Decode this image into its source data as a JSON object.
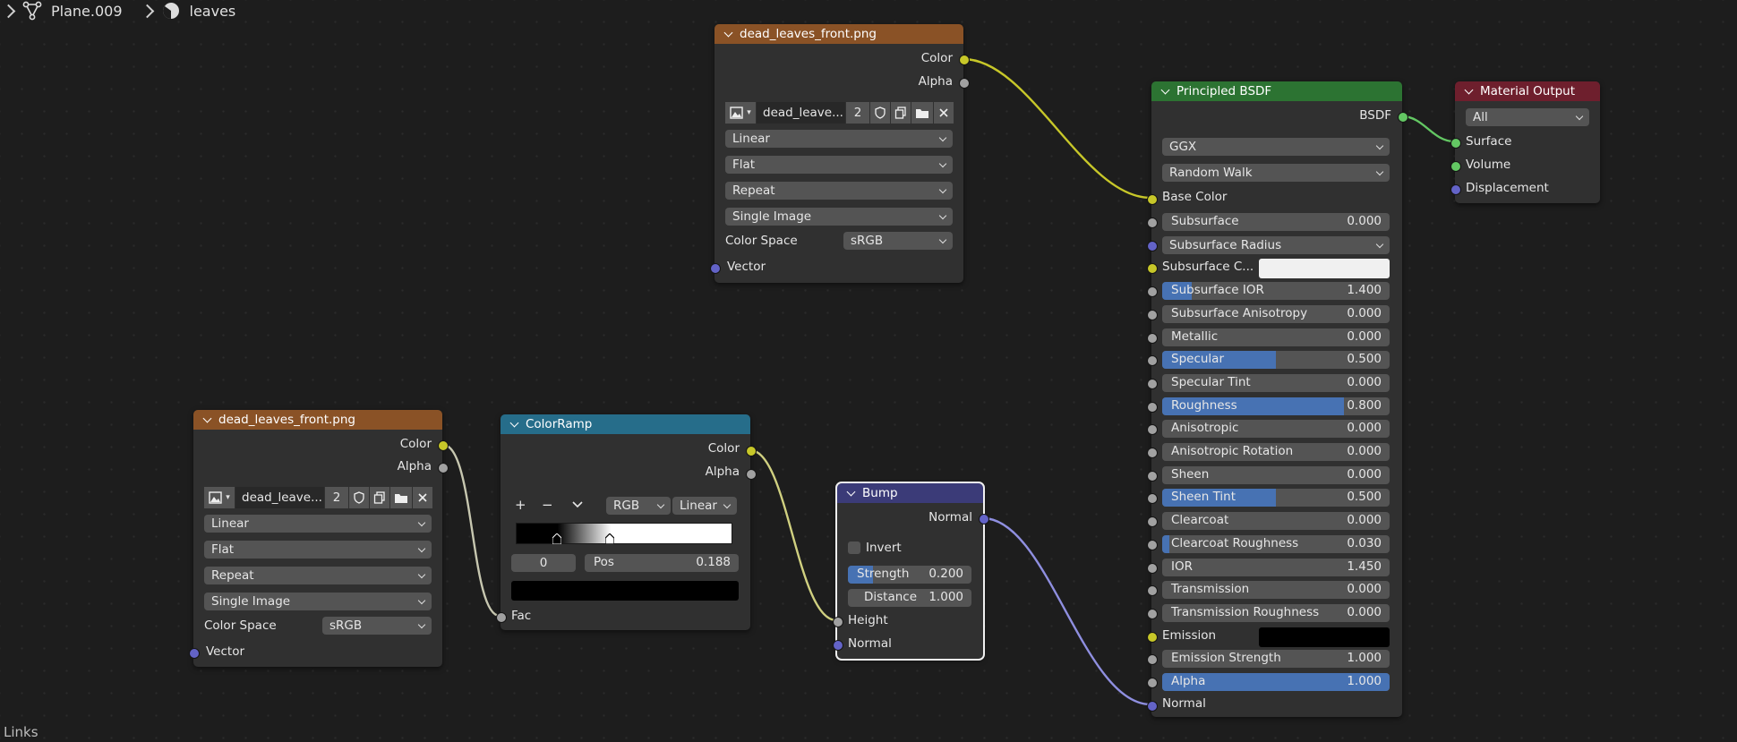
{
  "breadcrumb": {
    "object": "Plane.009",
    "material": "leaves"
  },
  "status": {
    "links_label": "Links"
  },
  "image_node_top": {
    "title": "dead_leaves_front.png",
    "outputs": [
      "Color",
      "Alpha"
    ],
    "image_name": "dead_leave...",
    "users": "2",
    "interpolation": "Linear",
    "projection": "Flat",
    "extension": "Repeat",
    "source": "Single Image",
    "color_space_label": "Color Space",
    "color_space": "sRGB",
    "input_vector": "Vector"
  },
  "image_node_left": {
    "title": "dead_leaves_front.png",
    "outputs": [
      "Color",
      "Alpha"
    ],
    "image_name": "dead_leave...",
    "users": "2",
    "interpolation": "Linear",
    "projection": "Flat",
    "extension": "Repeat",
    "source": "Single Image",
    "color_space_label": "Color Space",
    "color_space": "sRGB",
    "input_vector": "Vector"
  },
  "colorramp": {
    "title": "ColorRamp",
    "outputs": [
      "Color",
      "Alpha"
    ],
    "add": "+",
    "remove": "−",
    "color_mode": "RGB",
    "interpolation": "Linear",
    "active_index": "0",
    "pos_label": "Pos",
    "pos_value": "0.188",
    "input_fac": "Fac"
  },
  "bump": {
    "title": "Bump",
    "output": "Normal",
    "invert": "Invert",
    "strength_label": "Strength",
    "strength": "0.200",
    "strength_fill": 0.2,
    "distance_label": "Distance",
    "distance": "1.000",
    "inputs": [
      "Height",
      "Normal"
    ]
  },
  "bsdf": {
    "title": "Principled BSDF",
    "output": "BSDF",
    "distribution": "GGX",
    "subsurface_method": "Random Walk",
    "base_color": "Base Color",
    "rows": [
      {
        "label": "Subsurface",
        "value": "0.000",
        "fill": 0,
        "sock": "g"
      },
      {
        "label": "Subsurface Radius",
        "value": "",
        "fill": 0,
        "sock": "p",
        "dropdown": true
      },
      {
        "label": "Subsurface C...",
        "value": "",
        "fill": 0,
        "sock": "y",
        "swatch": "#f0f0f0"
      },
      {
        "label": "Subsurface IOR",
        "value": "1.400",
        "fill": 0.13,
        "sock": "g"
      },
      {
        "label": "Subsurface Anisotropy",
        "value": "0.000",
        "fill": 0,
        "sock": "g"
      },
      {
        "label": "Metallic",
        "value": "0.000",
        "fill": 0,
        "sock": "g"
      },
      {
        "label": "Specular",
        "value": "0.500",
        "fill": 0.5,
        "sock": "g"
      },
      {
        "label": "Specular Tint",
        "value": "0.000",
        "fill": 0,
        "sock": "g"
      },
      {
        "label": "Roughness",
        "value": "0.800",
        "fill": 0.8,
        "sock": "g"
      },
      {
        "label": "Anisotropic",
        "value": "0.000",
        "fill": 0,
        "sock": "g"
      },
      {
        "label": "Anisotropic Rotation",
        "value": "0.000",
        "fill": 0,
        "sock": "g"
      },
      {
        "label": "Sheen",
        "value": "0.000",
        "fill": 0,
        "sock": "g"
      },
      {
        "label": "Sheen Tint",
        "value": "0.500",
        "fill": 0.5,
        "sock": "g"
      },
      {
        "label": "Clearcoat",
        "value": "0.000",
        "fill": 0,
        "sock": "g"
      },
      {
        "label": "Clearcoat Roughness",
        "value": "0.030",
        "fill": 0.03,
        "sock": "g"
      },
      {
        "label": "IOR",
        "value": "1.450",
        "fill": 0,
        "sock": "g"
      },
      {
        "label": "Transmission",
        "value": "0.000",
        "fill": 0,
        "sock": "g"
      },
      {
        "label": "Transmission Roughness",
        "value": "0.000",
        "fill": 0,
        "sock": "g"
      },
      {
        "label": "Emission",
        "value": "",
        "fill": 0,
        "sock": "y",
        "swatch": "#000000"
      },
      {
        "label": "Emission Strength",
        "value": "1.000",
        "fill": 0,
        "sock": "g"
      },
      {
        "label": "Alpha",
        "value": "1.000",
        "fill": 1,
        "sock": "g"
      }
    ],
    "normal": "Normal"
  },
  "material_output": {
    "title": "Material Output",
    "target": "All",
    "inputs": [
      "Surface",
      "Volume",
      "Displacement"
    ]
  },
  "colors": {
    "image_header": "#8a5226",
    "converter_header": "#266d8a",
    "vector_header": "#3b3b78",
    "shader_header": "#2c7332",
    "output_header": "#6e1f2d",
    "slider_fill": "#4772b3",
    "socket_color": "#c7c729",
    "socket_float": "#a1a1a1",
    "socket_vector": "#6363c7",
    "socket_shader": "#63c763"
  }
}
